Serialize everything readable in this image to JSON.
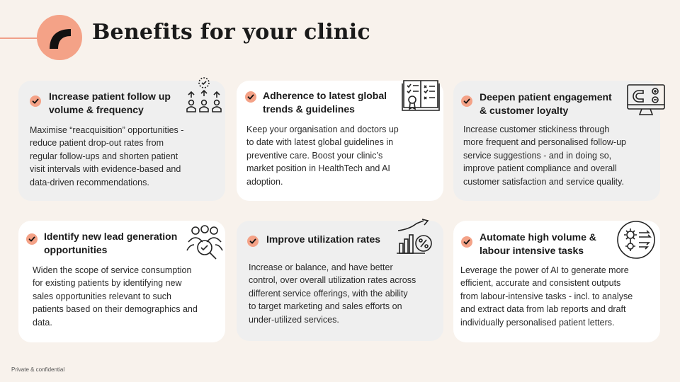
{
  "page": {
    "title": "Benefits for your clinic",
    "footer": "Private & confidential"
  },
  "colors": {
    "accent": "#f4a287",
    "background": "#f8f2ec",
    "card_grey": "#efefef",
    "card_white": "#ffffff"
  },
  "cards": [
    {
      "icon": "people-growth-icon",
      "title_lines": [
        "Increase patient follow up",
        "volume & frequency"
      ],
      "body_lines": [
        "Maximise “reacquisition” opportunities -",
        "reduce patient drop-out rates from",
        "regular follow-ups and shorten patient",
        "visit intervals with evidence-based and",
        "data-driven recommendations."
      ]
    },
    {
      "icon": "checklist-book-icon",
      "title_lines": [
        "Adherence to latest global",
        "trends & guidelines"
      ],
      "body_lines": [
        "Keep your organisation and doctors up",
        "to date with latest global guidelines in",
        "preventive care. Boost your clinic’s",
        "market position in HealthTech and AI",
        "adoption."
      ]
    },
    {
      "icon": "monitor-magnet-icon",
      "title_lines": [
        "Deepen patient engagement",
        "& customer loyalty"
      ],
      "body_lines": [
        "Increase customer stickiness through",
        "more frequent and personalised follow-up",
        "service suggestions - and in doing so,",
        "improve patient compliance and overall",
        "customer satisfaction and service quality."
      ]
    },
    {
      "icon": "people-search-icon",
      "title_lines": [
        "Identify new lead generation",
        "opportunities"
      ],
      "body_lines": [
        "Widen the scope of service consumption",
        "for existing patients by identifying new",
        "sales opportunities relevant to such",
        "patients based on their demographics and",
        "data."
      ]
    },
    {
      "icon": "growth-chart-percent-icon",
      "title_lines": [
        "Improve utilization rates"
      ],
      "body_lines": [
        "Increase or balance, and have better",
        "control, over overall utilization rates across",
        "different service offerings, with the ability",
        "to target marketing and sales efforts on",
        "under-utilized services."
      ]
    },
    {
      "icon": "automation-gears-icon",
      "title_lines": [
        "Automate high volume &",
        "labour intensive tasks"
      ],
      "body_lines": [
        "Leverage the power of AI to generate more",
        "efficient, accurate and consistent outputs",
        "from labour-intensive tasks - incl. to analyse",
        "and extract data from lab reports and draft",
        "individually personalised patient letters."
      ]
    }
  ]
}
